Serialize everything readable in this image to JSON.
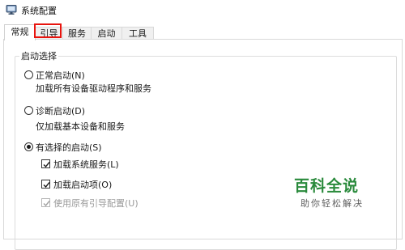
{
  "window": {
    "title": "系统配置",
    "icon": "msconfig-icon"
  },
  "tabs": [
    {
      "label": "常规",
      "active": true
    },
    {
      "label": "引导",
      "highlighted": true
    },
    {
      "label": "服务"
    },
    {
      "label": "启动"
    },
    {
      "label": "工具"
    }
  ],
  "startup_selection": {
    "legend": "启动选择",
    "options": [
      {
        "label": "正常启动(N)",
        "description": "加载所有设备驱动程序和服务",
        "selected": false
      },
      {
        "label": "诊断启动(D)",
        "description": "仅加载基本设备和服务",
        "selected": false
      },
      {
        "label": "有选择的启动(S)",
        "selected": true
      }
    ],
    "checkboxes": [
      {
        "label": "加载系统服务(L)",
        "checked": true,
        "enabled": true
      },
      {
        "label": "加载启动项(O)",
        "checked": true,
        "enabled": true
      },
      {
        "label": "使用原有引导配置(U)",
        "checked": true,
        "enabled": false
      }
    ]
  },
  "watermark": {
    "title": "百科全说",
    "subtitle": "助你轻松解决"
  },
  "colors": {
    "highlight_border": "#e8140e",
    "brand_green": "#2a8a3c"
  }
}
